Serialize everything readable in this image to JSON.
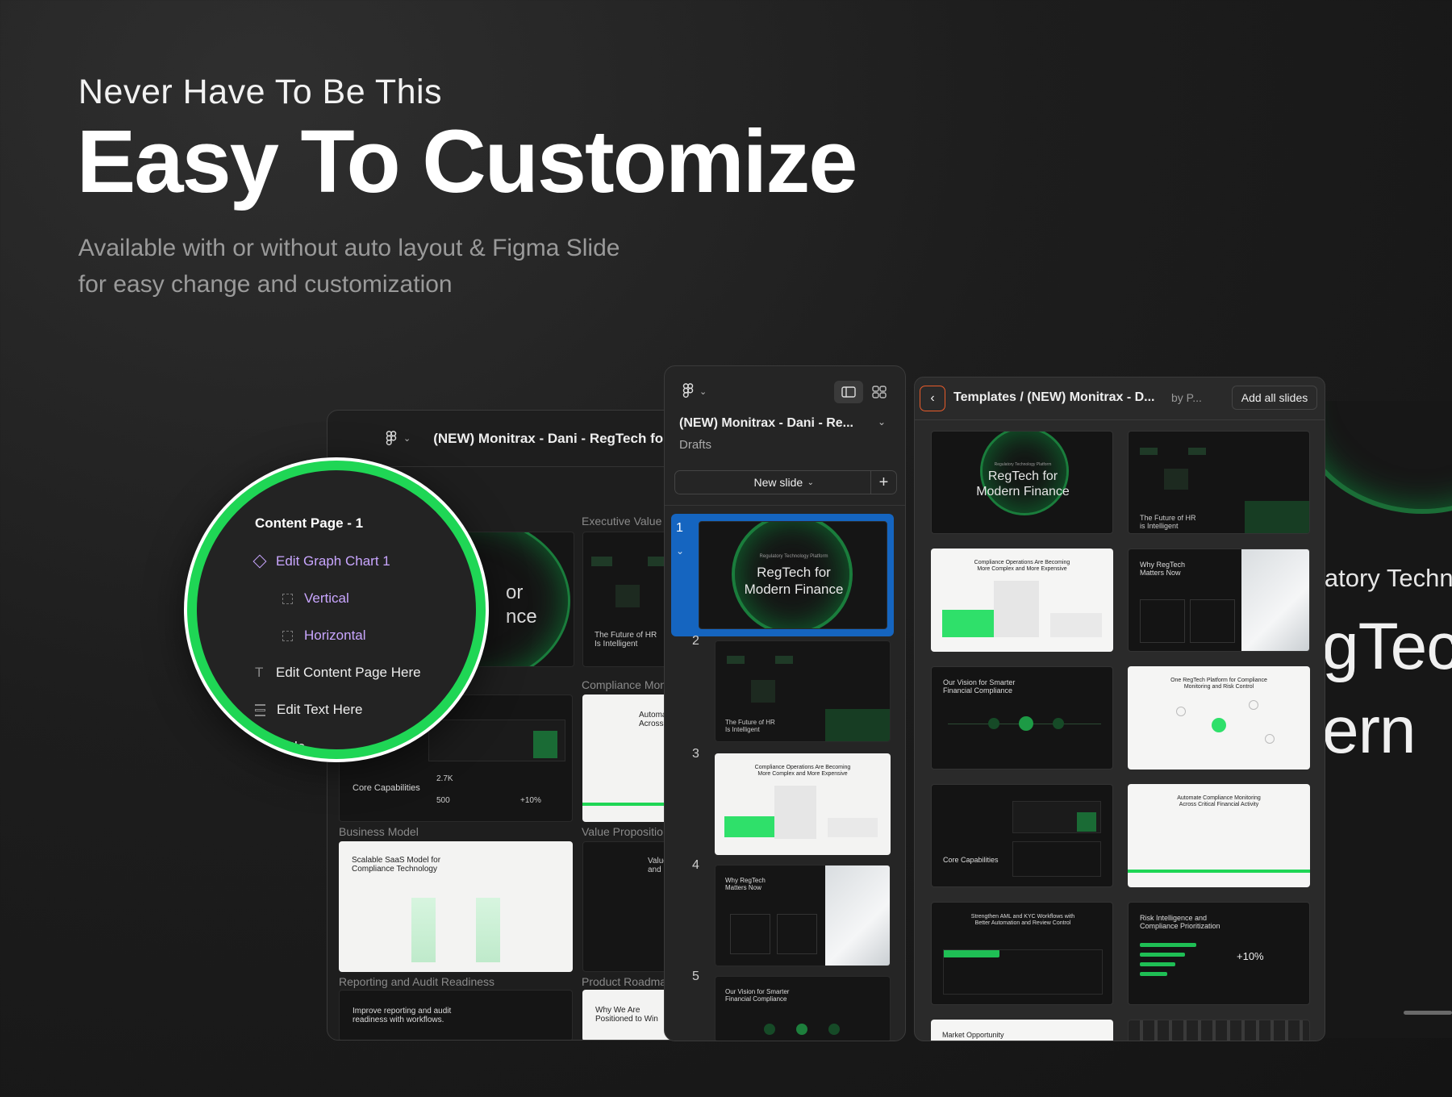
{
  "hero": {
    "kicker": "Never Have To Be This",
    "headline": "Easy To Customize",
    "subline_1": "Available with or without auto layout  & Figma Slide",
    "subline_2": "for easy change and customization"
  },
  "back_window": {
    "title": "(NEW) Monitrax - Dani - RegTech for Mod",
    "labels": {
      "executive": "Executive Value",
      "compliance": "Compliance Mon",
      "business": "Business Model",
      "value_prop": "Value Propositio",
      "reporting": "Reporting and Audit Readiness",
      "roadmap": "Product Roadma"
    },
    "thumbs": {
      "hero_fragment": "or\nnce",
      "future_hr": "The Future of HR\nIs Intelligent",
      "automate": "Automat\nAcross C",
      "core_cap": "Core Capabilities",
      "stat_1": "2.7K",
      "stat_2": "500",
      "stat_3": "+10%",
      "saas": "Scalable SaaS Model for\nCompliance Technology",
      "value_and": "Value A\nand",
      "improve": "Improve reporting and audit\nreadiness with workflows.",
      "why_we": "Why We Are\nPositioned to Win"
    }
  },
  "layers_lens": {
    "items": [
      {
        "label": "Content Page - 1",
        "icon": "frame-icon"
      },
      {
        "label": "Edit Graph Chart 1",
        "icon": "component-icon"
      },
      {
        "label": "Vertical",
        "icon": "instance-icon"
      },
      {
        "label": "Horizontal",
        "icon": "instance-icon"
      },
      {
        "label": "Edit Content Page Here",
        "icon": "text-icon"
      },
      {
        "label": "Edit Text Here",
        "icon": "auto-layout-icon"
      },
      {
        "label": "Tittle",
        "icon": "frame-icon"
      }
    ]
  },
  "slides_panel": {
    "file_title": "(NEW) Monitrax - Dani - Re...",
    "location": "Drafts",
    "new_slide": "New slide",
    "slides": [
      {
        "num": "1",
        "title": "RegTech for\nModern Finance",
        "kicker": "Regulatory Technology Platform",
        "selected": true
      },
      {
        "num": "2",
        "title": "The Future of HR\nIs Intelligent"
      },
      {
        "num": "3",
        "title": "Compliance Operations Are Becoming\nMore Complex and More Expensive"
      },
      {
        "num": "4",
        "title": "Why RegTech\nMatters Now"
      },
      {
        "num": "5",
        "title": "Our Vision for Smarter\nFinancial Compliance"
      }
    ]
  },
  "templates_panel": {
    "breadcrumb": "Templates / (NEW) Monitrax - D...",
    "byline": "by P...",
    "add_all": "Add all slides",
    "cells": [
      {
        "title": "RegTech for\nModern Finance",
        "kicker": "Regulatory Technology Platform",
        "theme": "dark"
      },
      {
        "title": "The Future of HR\nis Intelligent",
        "theme": "dark"
      },
      {
        "title": "Compliance Operations Are Becoming\nMore Complex and More Expensive",
        "theme": "light"
      },
      {
        "title": "Why RegTech\nMatters Now",
        "theme": "dark"
      },
      {
        "title": "Our Vision for Smarter\nFinancial Compliance",
        "theme": "dark"
      },
      {
        "title": "One RegTech Platform for Compliance\nMonitoring and Risk Control",
        "theme": "light"
      },
      {
        "title": "Core Capabilities",
        "theme": "dark"
      },
      {
        "title": "Automate Compliance Monitoring\nAcross Critical Financial Activity",
        "theme": "light"
      },
      {
        "title": "Strengthen AML and KYC Workflows with\nBetter Automation and Review Control",
        "theme": "dark"
      },
      {
        "title": "Risk Intelligence and\nCompliance Prioritization",
        "stat": "+10%",
        "theme": "dark"
      },
      {
        "title": "Market Opportunity",
        "theme": "light"
      },
      {
        "title": "",
        "theme": "dark"
      }
    ]
  },
  "preview": {
    "line_1": "latory Techn",
    "line_2": "gTec",
    "line_3": "ern"
  },
  "colors": {
    "accent_green": "#1fd655",
    "selection_blue": "#1565c0",
    "lavender": "#c9a6ff"
  }
}
